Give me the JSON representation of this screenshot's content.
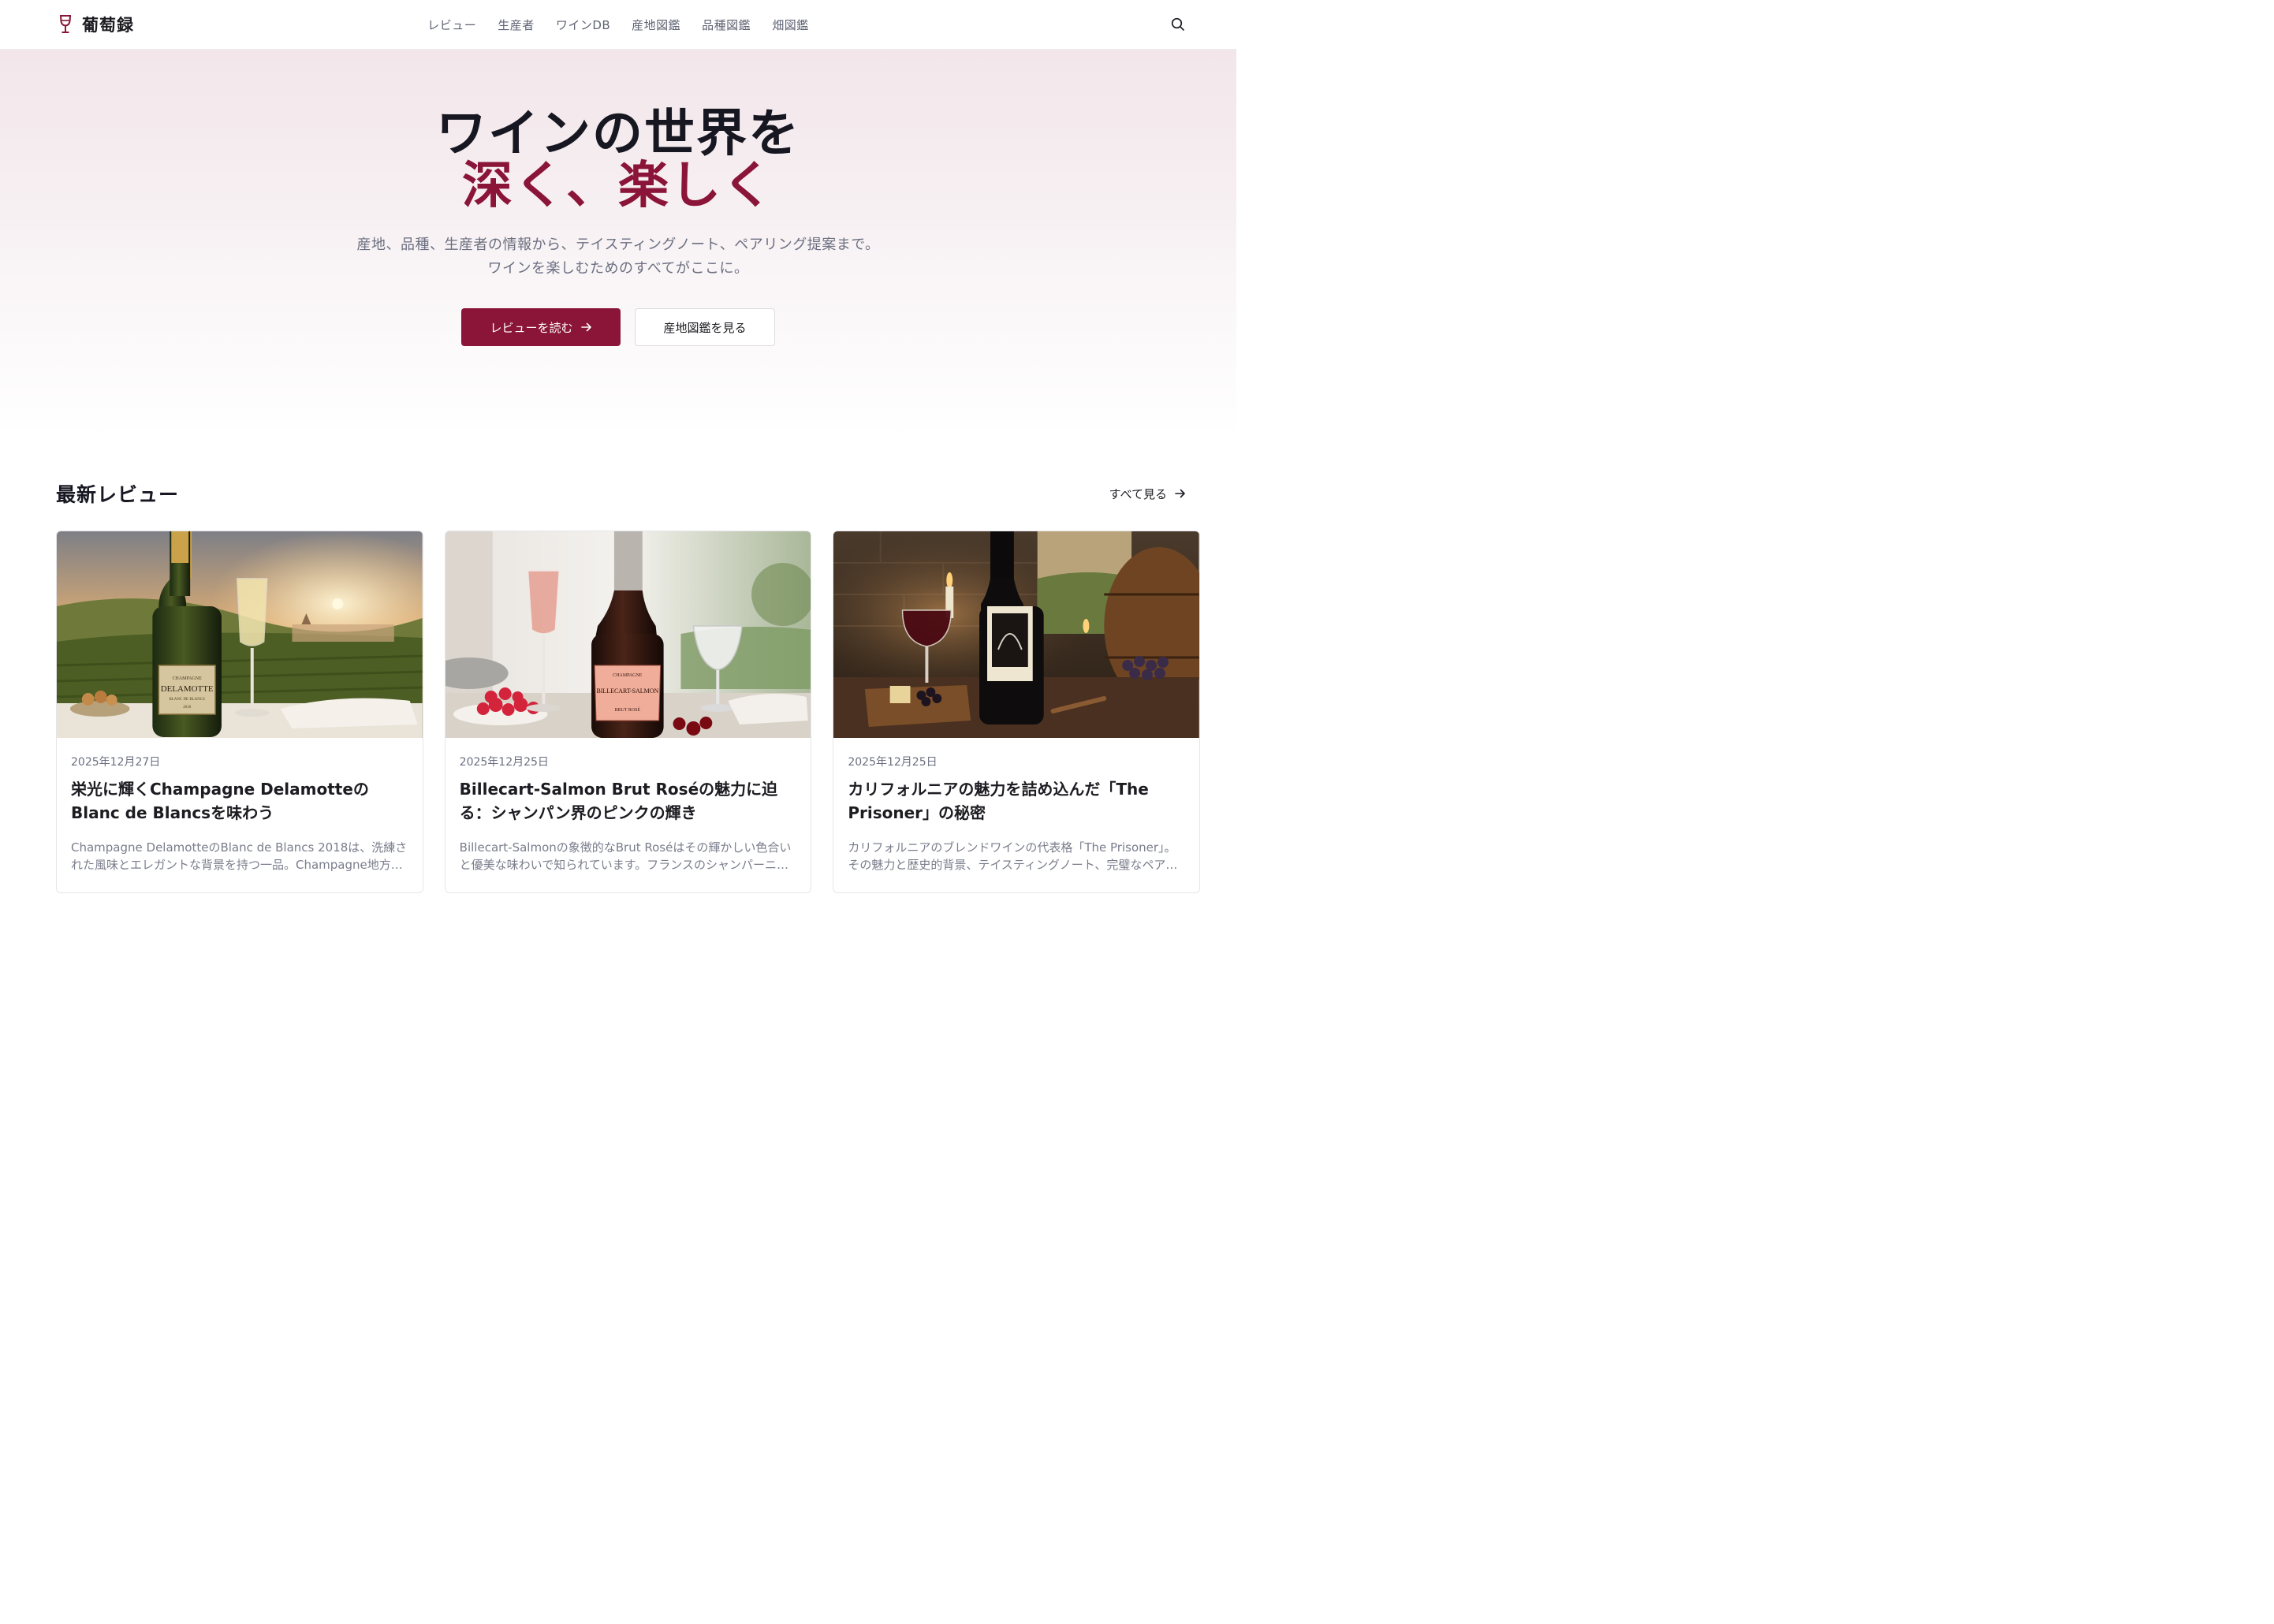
{
  "brand": {
    "name": "葡萄録",
    "accent": "#8a1538"
  },
  "nav": {
    "items": [
      "レビュー",
      "生産者",
      "ワインDB",
      "産地図鑑",
      "品種図鑑",
      "畑図鑑"
    ]
  },
  "hero": {
    "title_line1": "ワインの世界を",
    "title_line2": "深く、楽しく",
    "subtitle_line1": "産地、品種、生産者の情報から、テイスティングノート、ペアリング提案まで。",
    "subtitle_line2": "ワインを楽しむためのすべてがここに。",
    "primary_button": "レビューを読む",
    "secondary_button": "産地図鑑を見る"
  },
  "latest": {
    "title": "最新レビュー",
    "see_all": "すべて見る",
    "cards": [
      {
        "date": "2025年12月27日",
        "title": "栄光に輝くChampagne DelamotteのBlanc de Blancsを味わう",
        "excerpt": "Champagne DelamotteのBlanc de Blancs 2018は、洗練された風味とエレガントな背景を持つ一品。Champagne地方の…",
        "label_brand": "DELAMOTTE",
        "label_top": "CHAMPAGNE",
        "label_sub": "BLANC DE BLANCS",
        "label_year": "2018"
      },
      {
        "date": "2025年12月25日",
        "title": "Billecart-Salmon Brut Roséの魅力に迫る：シャンパン界のピンクの輝き",
        "excerpt": "Billecart-Salmonの象徴的なBrut Roséはその輝かしい色合いと優美な味わいで知られています。フランスのシャンパーニ…",
        "label_brand": "BILLECART-SALMON",
        "label_top": "CHAMPAGNE",
        "label_sub": "BRUT ROSÉ",
        "label_neck": "BILLECART-SALMON"
      },
      {
        "date": "2025年12月25日",
        "title": "カリフォルニアの魅力を詰め込んだ「The Prisoner」の秘密",
        "excerpt": "カリフォルニアのブレンドワインの代表格「The Prisoner」。その魅力と歴史的背景、テイスティングノート、完璧なペア…"
      }
    ]
  }
}
